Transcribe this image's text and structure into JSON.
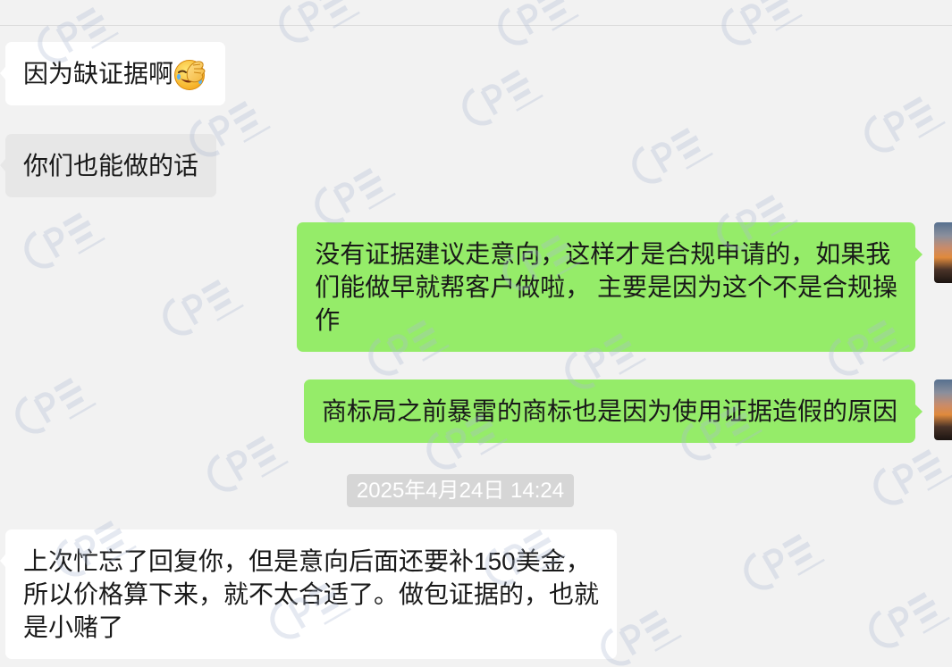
{
  "colors": {
    "background": "#f2f2f2",
    "incoming_bubble": "#ffffff",
    "incoming_bubble_selected": "#e7e7e7",
    "outgoing_bubble": "#95ec69",
    "text": "#191919",
    "timestamp_bg": "#d6d6d6",
    "timestamp_text": "#ffffff"
  },
  "messages": [
    {
      "lines": [
        "因为缺证据啊"
      ],
      "emoji_icon": "facepalm-emoji-icon"
    },
    {
      "lines": [
        "你们也能做的话"
      ]
    },
    {
      "lines": [
        "没有证据建议走意向，这样才是合规申请的，如果我",
        "们能做早就帮客户做啦， 主要是因为这个不是合规操",
        "作"
      ],
      "avatar_icon": "sunset-photo-avatar-icon"
    },
    {
      "lines": [
        "商标局之前暴雷的商标也是因为使用证据造假的原因"
      ],
      "avatar_icon": "sunset-photo-avatar-icon"
    },
    {
      "lines": [
        "上次忙忘了回复你，但是意向后面还要补150美金，",
        "所以价格算下来，就不太合适了。做包证据的，也就",
        "是小赌了"
      ]
    }
  ],
  "timestamp": "2025年4月24日 14:24"
}
